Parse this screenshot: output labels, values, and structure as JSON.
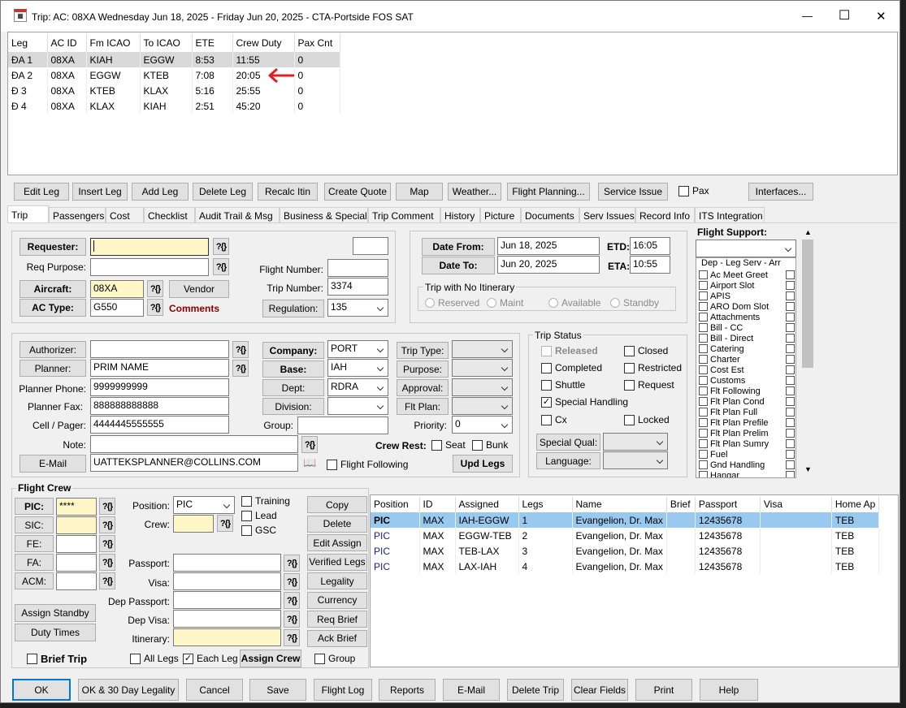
{
  "window": {
    "title": "Trip:  AC: 08XA  Wednesday Jun 18, 2025 - Friday Jun 20, 2025 - CTA-Portside FOS SAT",
    "min": "—",
    "max": "☐",
    "close": "✕"
  },
  "legs": {
    "headers": [
      "Leg",
      "AC ID",
      "Fm ICAO",
      "To ICAO",
      "ETE",
      "Crew Duty",
      "Pax Cnt"
    ],
    "rows": [
      [
        "ĐA 1",
        "08XA",
        "KIAH",
        "EGGW",
        "8:53",
        "11:55",
        "0"
      ],
      [
        "ĐA 2",
        "08XA",
        "EGGW",
        "KTEB",
        "7:08",
        "20:05",
        "0"
      ],
      [
        "Đ 3",
        "08XA",
        "KTEB",
        "KLAX",
        "5:16",
        "25:55",
        "0"
      ],
      [
        "Đ 4",
        "08XA",
        "KLAX",
        "KIAH",
        "2:51",
        "45:20",
        "0"
      ]
    ]
  },
  "toolbar": {
    "edit_leg": "Edit Leg",
    "insert_leg": "Insert Leg",
    "add_leg": "Add Leg",
    "delete_leg": "Delete Leg",
    "recalc": "Recalc Itin",
    "create_quote": "Create Quote",
    "map": "Map",
    "weather": "Weather...",
    "flight_planning": "Flight Planning...",
    "service_issue": "Service Issue",
    "pax": "Pax",
    "interfaces": "Interfaces..."
  },
  "tabs": [
    "Trip",
    "Passengers",
    "Cost",
    "Checklist",
    "Audit Trail & Msg",
    "Business & Special",
    "Trip Comment",
    "History",
    "Picture",
    "Documents",
    "Serv Issues",
    "Record Info",
    "ITS Integration"
  ],
  "req": {
    "requester": "Requester:",
    "req_purpose": "Req Purpose:",
    "aircraft": "Aircraft:",
    "aircraft_val": "08XA",
    "vendor": "Vendor",
    "ac_type": "AC Type:",
    "ac_type_val": "G550",
    "comments": "Comments",
    "flight_number": "Flight Number:",
    "trip_number": "Trip Number:",
    "trip_number_val": "3374",
    "regulation": "Regulation:",
    "regulation_val": "135"
  },
  "dates": {
    "date_from": "Date From:",
    "date_from_val": "Jun 18, 2025",
    "date_to": "Date To:",
    "date_to_val": "Jun 20, 2025",
    "etd": "ETD:",
    "etd_val": "16:05",
    "eta": "ETA:",
    "eta_val": "10:55",
    "no_itin": "Trip with No Itinerary",
    "reserved": "Reserved",
    "maint": "Maint",
    "available": "Available",
    "standby": "Standby"
  },
  "support": {
    "title": "Flight Support:",
    "header": "Dep - Leg Serv - Arr",
    "items": [
      "Ac Meet Greet",
      "Airport Slot",
      "APIS",
      "ARO Dom Slot",
      "Attachments",
      "Bill - CC",
      "Bill - Direct",
      "Catering",
      "Charter",
      "Cost Est",
      "Customs",
      "Flt Following",
      "Flt Plan Cond",
      "Flt Plan Full",
      "Flt Plan Prefile",
      "Flt Plan Prelim",
      "Flt Plan Sumry",
      "Fuel",
      "Gnd Handling",
      "Hangar"
    ]
  },
  "auth": {
    "authorizer": "Authorizer:",
    "planner": "Planner:",
    "planner_val": "PRIM NAME",
    "planner_phone": "Planner Phone:",
    "planner_phone_val": "9999999999",
    "planner_fax": "Planner Fax:",
    "planner_fax_val": "888888888888",
    "cell": "Cell / Pager:",
    "cell_val": "4444445555555",
    "note": "Note:",
    "email": "E-Mail",
    "email_val": "UATTEKSPLANNER@COLLINS.COM",
    "company": "Company:",
    "company_val": "PORT",
    "base": "Base:",
    "base_val": "IAH",
    "dept": "Dept:",
    "dept_val": "RDRA",
    "division": "Division:",
    "group": "Group:",
    "trip_type": "Trip Type:",
    "purpose": "Purpose:",
    "approval": "Approval:",
    "flt_plan": "Flt Plan:",
    "priority": "Priority:",
    "priority_val": "0",
    "crew_rest": "Crew Rest:",
    "seat": "Seat",
    "bunk": "Bunk",
    "flight_following": "Flight Following",
    "upd_legs": "Upd Legs"
  },
  "status": {
    "title": "Trip Status",
    "released": "Released",
    "closed": "Closed",
    "completed": "Completed",
    "restricted": "Restricted",
    "shuttle": "Shuttle",
    "request": "Request",
    "special": "Special Handling",
    "cx": "Cx",
    "locked": "Locked",
    "special_qual": "Special Qual:",
    "language": "Language:"
  },
  "crew": {
    "title": "Flight Crew",
    "pic": "PIC:",
    "pic_val": "****",
    "sic": "SIC:",
    "fe": "FE:",
    "fa": "FA:",
    "acm": "ACM:",
    "position": "Position:",
    "position_val": "PIC",
    "crew": "Crew:",
    "training": "Training",
    "lead": "Lead",
    "gsc": "GSC",
    "passport": "Passport:",
    "visa": "Visa:",
    "dep_passport": "Dep Passport:",
    "dep_visa": "Dep Visa:",
    "itinerary": "Itinerary:",
    "assign_standby": "Assign Standby",
    "duty_times": "Duty Times",
    "brief_trip": "Brief Trip",
    "all_legs": "All Legs",
    "each_leg": "Each Leg",
    "assign_crew": "Assign Crew",
    "group": "Group",
    "buttons": [
      "Copy",
      "Delete",
      "Edit Assign",
      "Verified Legs",
      "Legality",
      "Currency",
      "Req Brief",
      "Ack Brief"
    ],
    "headers": [
      "Position",
      "ID",
      "Assigned",
      "Legs",
      "Name",
      "Brief",
      "Passport",
      "Visa",
      "Home Ap"
    ],
    "rows": [
      [
        "PIC",
        "MAX",
        "IAH-EGGW",
        "1",
        "Evangelion, Dr. Max",
        "",
        "12435678",
        "",
        "TEB"
      ],
      [
        "PIC",
        "MAX",
        "EGGW-TEB",
        "2",
        "Evangelion, Dr. Max",
        "",
        "12435678",
        "",
        "TEB"
      ],
      [
        "PIC",
        "MAX",
        "TEB-LAX",
        "3",
        "Evangelion, Dr. Max",
        "",
        "12435678",
        "",
        "TEB"
      ],
      [
        "PIC",
        "MAX",
        "LAX-IAH",
        "4",
        "Evangelion, Dr. Max",
        "",
        "12435678",
        "",
        "TEB"
      ]
    ]
  },
  "bottom": [
    "OK",
    "OK & 30 Day Legality",
    "Cancel",
    "Save",
    "Flight Log",
    "Reports",
    "E-Mail",
    "Delete Trip",
    "Clear Fields",
    "Print",
    "Help"
  ],
  "colors": {
    "selected_row": "#99c9ef",
    "yellow": "#fff7c8",
    "arrow": "#e02020",
    "comments": "#8b0000"
  }
}
